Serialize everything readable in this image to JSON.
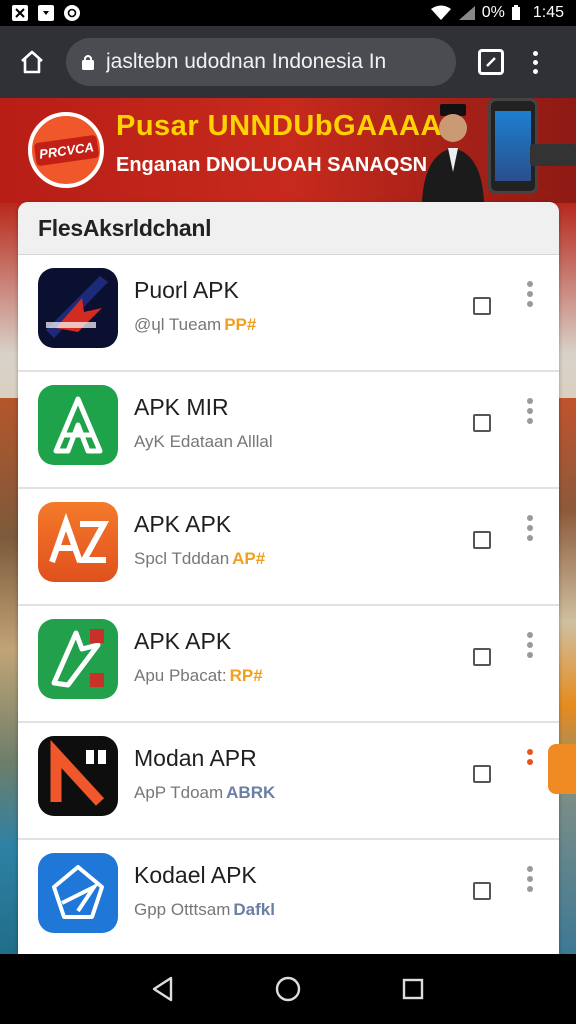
{
  "status_bar": {
    "battery": "0%",
    "time": "1:45"
  },
  "browser": {
    "url": "jasltebn udodnan Indonesia In"
  },
  "banner": {
    "logo_text": "PRCVCA",
    "title": "Pusar UNNDUbGAAAA",
    "subtitle": "Enganan DNOLUOAH SANAQSN"
  },
  "list": {
    "header": "FlesAksrldchanl",
    "items": [
      {
        "name": "Puorl APK",
        "desc": "@ɥl Tueam",
        "tag": "PP#",
        "tag_color": "#f0a020",
        "icon": "dark-blue-arrow-app-icon"
      },
      {
        "name": "APK MIR",
        "desc": "AyK Edataan Alllal",
        "tag": "",
        "tag_color": "#777777",
        "icon": "green-triangle-app-icon"
      },
      {
        "name": "APK APK",
        "desc": "Spcl Tdddan",
        "tag": "AP#",
        "tag_color": "#f0a020",
        "icon": "orange-az-app-icon"
      },
      {
        "name": "APK APK",
        "desc": "Apu Pbacat:",
        "tag": "RP#",
        "tag_color": "#f0a020",
        "icon": "green-arrow-app-icon"
      },
      {
        "name": "Modan APR",
        "desc": "ApP Tdoam",
        "tag": "ABRK",
        "tag_color": "#6a7fa3",
        "icon": "black-n-app-icon"
      },
      {
        "name": "Kodael APK",
        "desc": "Gpp Otttsam",
        "tag": "Dafkl",
        "tag_color": "#6a7fa3",
        "icon": "blue-star-app-icon"
      }
    ]
  },
  "colors": {
    "banner_red": "#c72a1d",
    "banner_yellow": "#ffd200",
    "accent_orange": "#f08a22"
  }
}
